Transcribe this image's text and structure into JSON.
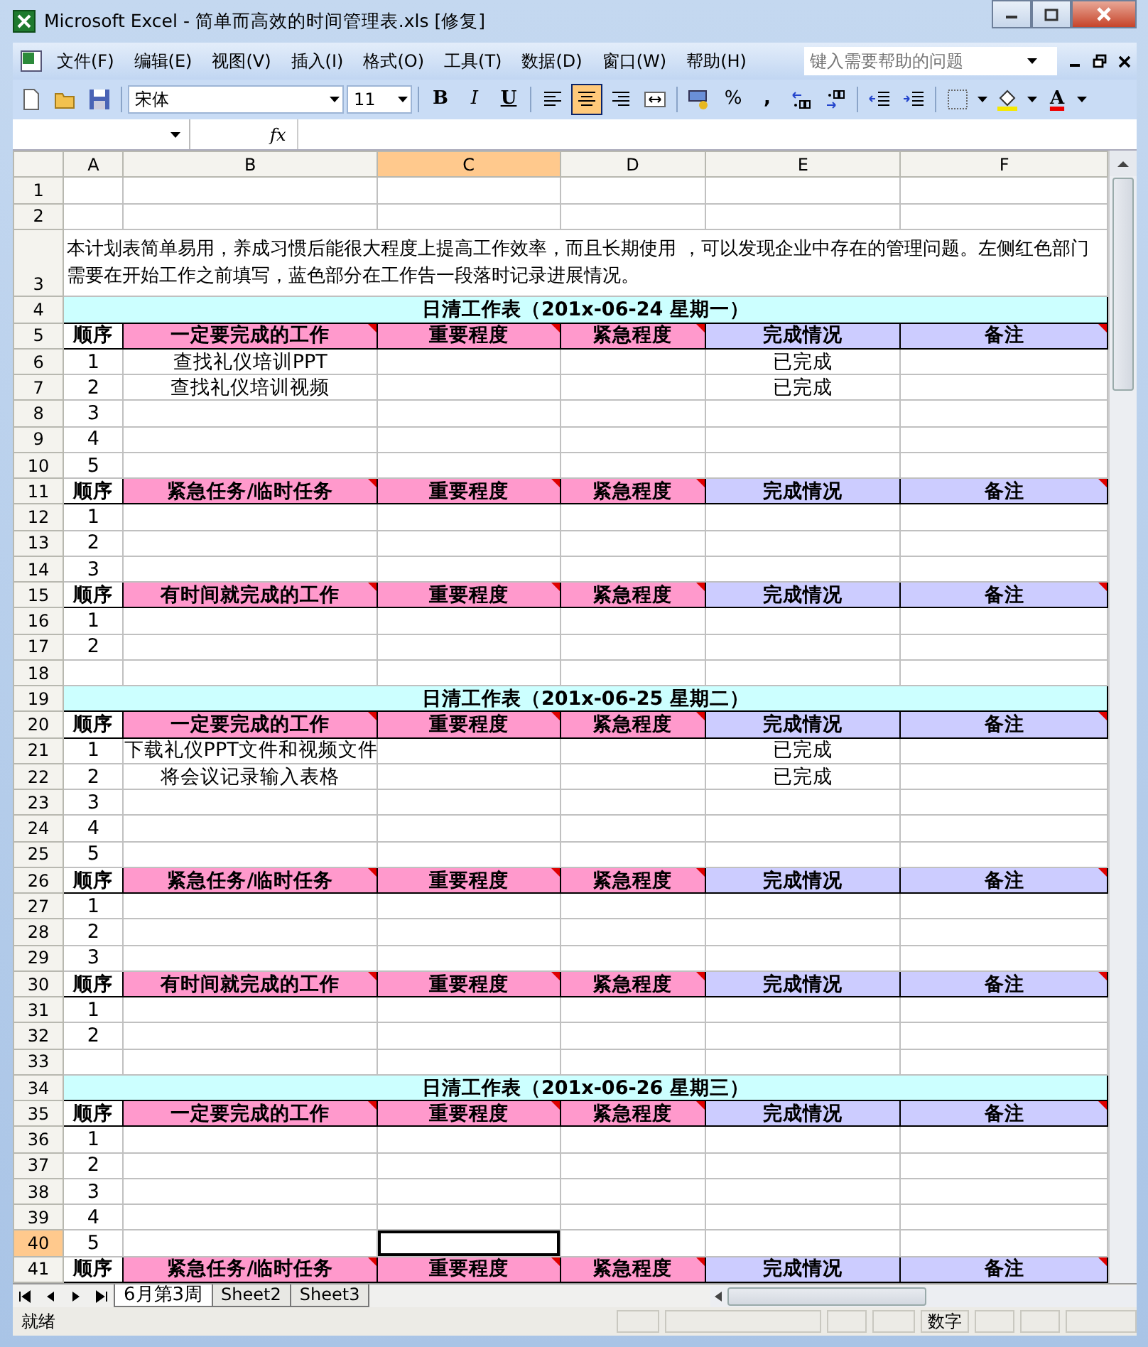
{
  "window": {
    "title": "Microsoft Excel - 简单而高效的时间管理表.xls  [修复]"
  },
  "menu": [
    "文件(F)",
    "编辑(E)",
    "视图(V)",
    "插入(I)",
    "格式(O)",
    "工具(T)",
    "数据(D)",
    "窗口(W)",
    "帮助(H)"
  ],
  "help_search": {
    "placeholder": "键入需要帮助的问题"
  },
  "toolbar": {
    "font": "宋体",
    "size": "11",
    "format_buttons": [
      "B",
      "I",
      "U"
    ],
    "alignment": [
      {
        "kind": "left",
        "selected": false
      },
      {
        "kind": "center",
        "selected": true
      },
      {
        "kind": "right",
        "selected": false
      },
      {
        "kind": "merge",
        "selected": false
      }
    ],
    "percent": "%",
    "comma": ",",
    "font_color": "A"
  },
  "formula_bar": {
    "fx": "fx"
  },
  "columns": [
    {
      "label": "A",
      "selected": false
    },
    {
      "label": "B",
      "selected": false
    },
    {
      "label": "C",
      "selected": true
    },
    {
      "label": "D",
      "selected": false
    },
    {
      "label": "E",
      "selected": false
    },
    {
      "label": "F",
      "selected": false
    }
  ],
  "rows": [
    {
      "num": "1",
      "kind": "blank",
      "selected": false
    },
    {
      "num": "2",
      "kind": "blank",
      "selected": false
    },
    {
      "num": "3",
      "kind": "note",
      "selected": false,
      "text": "本计划表简单易用，养成习惯后能很大程度上提高工作效率，而且长期使用 ，可以发现企业中存在的管理问题。左侧红色部门需要在开始工作之前填写，蓝色部分在工作告一段落时记录进展情况。"
    },
    {
      "num": "4",
      "kind": "title",
      "selected": false,
      "text": "日清工作表（201x-06-24 星期一）"
    },
    {
      "num": "5",
      "kind": "header",
      "selected": false,
      "cells": [
        {
          "text": "顺序",
          "comment": false
        },
        {
          "text": "一定要完成的工作",
          "color": "#ff99cc",
          "comment": true
        },
        {
          "text": "重要程度",
          "color": "#ff99cc",
          "comment": true
        },
        {
          "text": "紧急程度",
          "color": "#ff99cc",
          "comment": true
        },
        {
          "text": "完成情况",
          "color": "#ccccff",
          "comment": false
        },
        {
          "text": "备注",
          "color": "#ccccff",
          "comment": true
        }
      ]
    },
    {
      "num": "6",
      "kind": "item",
      "selected": false,
      "seq": "1",
      "task": "查找礼仪培训PPT",
      "status": "已完成"
    },
    {
      "num": "7",
      "kind": "item",
      "selected": false,
      "seq": "2",
      "task": "查找礼仪培训视频",
      "status": "已完成"
    },
    {
      "num": "8",
      "kind": "item",
      "selected": false,
      "seq": "3"
    },
    {
      "num": "9",
      "kind": "item",
      "selected": false,
      "seq": "4"
    },
    {
      "num": "10",
      "kind": "item",
      "selected": false,
      "seq": "5"
    },
    {
      "num": "11",
      "kind": "header",
      "selected": false,
      "cells": [
        {
          "text": "顺序",
          "comment": false
        },
        {
          "text": "紧急任务/临时任务",
          "color": "#ff99cc",
          "comment": true
        },
        {
          "text": "重要程度",
          "color": "#ff99cc",
          "comment": true
        },
        {
          "text": "紧急程度",
          "color": "#ff99cc",
          "comment": true
        },
        {
          "text": "完成情况",
          "color": "#ccccff",
          "comment": false
        },
        {
          "text": "备注",
          "color": "#ccccff",
          "comment": true
        }
      ]
    },
    {
      "num": "12",
      "kind": "item",
      "selected": false,
      "seq": "1"
    },
    {
      "num": "13",
      "kind": "item",
      "selected": false,
      "seq": "2"
    },
    {
      "num": "14",
      "kind": "item",
      "selected": false,
      "seq": "3"
    },
    {
      "num": "15",
      "kind": "header",
      "selected": false,
      "cells": [
        {
          "text": "顺序",
          "comment": false
        },
        {
          "text": "有时间就完成的工作",
          "color": "#ff99cc",
          "comment": true
        },
        {
          "text": "重要程度",
          "color": "#ff99cc",
          "comment": true
        },
        {
          "text": "紧急程度",
          "color": "#ff99cc",
          "comment": true
        },
        {
          "text": "完成情况",
          "color": "#ccccff",
          "comment": false
        },
        {
          "text": "备注",
          "color": "#ccccff",
          "comment": true
        }
      ]
    },
    {
      "num": "16",
      "kind": "item",
      "selected": false,
      "seq": "1"
    },
    {
      "num": "17",
      "kind": "item",
      "selected": false,
      "seq": "2"
    },
    {
      "num": "18",
      "kind": "blank",
      "selected": false
    },
    {
      "num": "19",
      "kind": "title",
      "selected": false,
      "text": "日清工作表（201x-06-25 星期二）"
    },
    {
      "num": "20",
      "kind": "header",
      "selected": false,
      "cells": [
        {
          "text": "顺序",
          "comment": false
        },
        {
          "text": "一定要完成的工作",
          "color": "#ff99cc",
          "comment": true
        },
        {
          "text": "重要程度",
          "color": "#ff99cc",
          "comment": true
        },
        {
          "text": "紧急程度",
          "color": "#ff99cc",
          "comment": true
        },
        {
          "text": "完成情况",
          "color": "#ccccff",
          "comment": false
        },
        {
          "text": "备注",
          "color": "#ccccff",
          "comment": true
        }
      ]
    },
    {
      "num": "21",
      "kind": "item",
      "selected": false,
      "seq": "1",
      "task": "下载礼仪PPT文件和视频文件",
      "status": "已完成"
    },
    {
      "num": "22",
      "kind": "item",
      "selected": false,
      "seq": "2",
      "task": "将会议记录输入表格",
      "status": "已完成"
    },
    {
      "num": "23",
      "kind": "item",
      "selected": false,
      "seq": "3"
    },
    {
      "num": "24",
      "kind": "item",
      "selected": false,
      "seq": "4"
    },
    {
      "num": "25",
      "kind": "item",
      "selected": false,
      "seq": "5"
    },
    {
      "num": "26",
      "kind": "header",
      "selected": false,
      "cells": [
        {
          "text": "顺序",
          "comment": false
        },
        {
          "text": "紧急任务/临时任务",
          "color": "#ff99cc",
          "comment": true
        },
        {
          "text": "重要程度",
          "color": "#ff99cc",
          "comment": true
        },
        {
          "text": "紧急程度",
          "color": "#ff99cc",
          "comment": true
        },
        {
          "text": "完成情况",
          "color": "#ccccff",
          "comment": false
        },
        {
          "text": "备注",
          "color": "#ccccff",
          "comment": true
        }
      ]
    },
    {
      "num": "27",
      "kind": "item",
      "selected": false,
      "seq": "1"
    },
    {
      "num": "28",
      "kind": "item",
      "selected": false,
      "seq": "2"
    },
    {
      "num": "29",
      "kind": "item",
      "selected": false,
      "seq": "3"
    },
    {
      "num": "30",
      "kind": "header",
      "selected": false,
      "cells": [
        {
          "text": "顺序",
          "comment": false
        },
        {
          "text": "有时间就完成的工作",
          "color": "#ff99cc",
          "comment": true
        },
        {
          "text": "重要程度",
          "color": "#ff99cc",
          "comment": true
        },
        {
          "text": "紧急程度",
          "color": "#ff99cc",
          "comment": true
        },
        {
          "text": "完成情况",
          "color": "#ccccff",
          "comment": false
        },
        {
          "text": "备注",
          "color": "#ccccff",
          "comment": true
        }
      ]
    },
    {
      "num": "31",
      "kind": "item",
      "selected": false,
      "seq": "1"
    },
    {
      "num": "32",
      "kind": "item",
      "selected": false,
      "seq": "2"
    },
    {
      "num": "33",
      "kind": "blank",
      "selected": false
    },
    {
      "num": "34",
      "kind": "title",
      "selected": false,
      "text": "日清工作表（201x-06-26 星期三）"
    },
    {
      "num": "35",
      "kind": "header",
      "selected": false,
      "cells": [
        {
          "text": "顺序",
          "comment": false
        },
        {
          "text": "一定要完成的工作",
          "color": "#ff99cc",
          "comment": true
        },
        {
          "text": "重要程度",
          "color": "#ff99cc",
          "comment": true
        },
        {
          "text": "紧急程度",
          "color": "#ff99cc",
          "comment": true
        },
        {
          "text": "完成情况",
          "color": "#ccccff",
          "comment": false
        },
        {
          "text": "备注",
          "color": "#ccccff",
          "comment": true
        }
      ]
    },
    {
      "num": "36",
      "kind": "item",
      "selected": false,
      "seq": "1"
    },
    {
      "num": "37",
      "kind": "item",
      "selected": false,
      "seq": "2"
    },
    {
      "num": "38",
      "kind": "item",
      "selected": false,
      "seq": "3"
    },
    {
      "num": "39",
      "kind": "item",
      "selected": false,
      "seq": "4"
    },
    {
      "num": "40",
      "kind": "item",
      "selected": true,
      "seq": "5"
    },
    {
      "num": "41",
      "kind": "header",
      "selected": false,
      "cells": [
        {
          "text": "顺序",
          "comment": false
        },
        {
          "text": "紧急任务/临时任务",
          "color": "#ff99cc",
          "comment": true
        },
        {
          "text": "重要程度",
          "color": "#ff99cc",
          "comment": true
        },
        {
          "text": "紧急程度",
          "color": "#ff99cc",
          "comment": true
        },
        {
          "text": "完成情况",
          "color": "#ccccff",
          "comment": false
        },
        {
          "text": "备注",
          "color": "#ccccff",
          "comment": true
        }
      ]
    }
  ],
  "sheet_tabs": [
    {
      "label": "6月第3周",
      "selected": true
    },
    {
      "label": "Sheet2",
      "selected": false
    },
    {
      "label": "Sheet3",
      "selected": false
    }
  ],
  "status_bar": {
    "state": "就绪",
    "mode": "数字"
  }
}
